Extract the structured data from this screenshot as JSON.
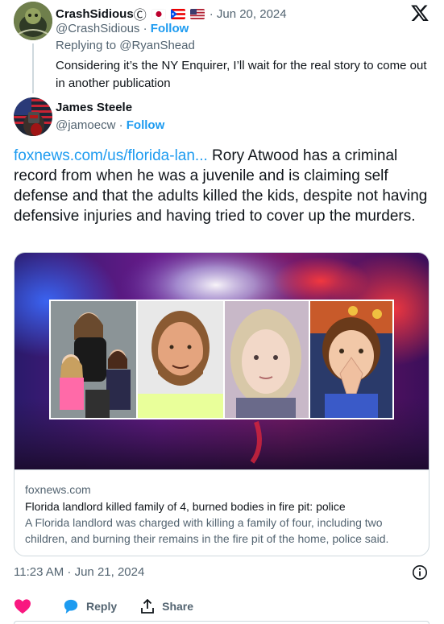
{
  "parent_tweet": {
    "author_name": "CrashSidious",
    "name_symbol": "Ⓒ",
    "posted": "· Jun 20, 2024",
    "handle": "@CrashSidious",
    "separator": "·",
    "follow_label": "Follow",
    "replying_to": "Replying to @RyanShead",
    "text": "Considering it’s the NY Enquirer, I’ll wait for the real story to come out in another publication",
    "flags": [
      "japan-flag",
      "puerto-rico-flag",
      "usa-flag"
    ]
  },
  "main_tweet": {
    "author_name": "James Steele",
    "handle": "@jamoecw",
    "separator": "·",
    "follow_label": "Follow",
    "link_text": "foxnews.com/us/florida-lan...",
    "text": " Rory Atwood has a criminal record from when he was a juvenile and is claiming self defense and that the adults killed the kids, despite not having defensive injuries and having tried to cover up the murders."
  },
  "link_card": {
    "domain": "foxnews.com",
    "title": "Florida landlord killed family of 4, burned bodies in fire pit: police",
    "description": "A Florida landlord was charged with killing a family of four, including two children, and burning their remains in the fire pit of the home, police said."
  },
  "timestamp": "11:23 AM · Jun 21, 2024",
  "actions": {
    "like_label": "",
    "reply_label": "Reply",
    "share_label": "Share"
  },
  "colors": {
    "accent": "#1d9bf0",
    "like": "#f91880",
    "muted": "#536471",
    "text": "#0f1419",
    "border": "#cfd9de"
  }
}
